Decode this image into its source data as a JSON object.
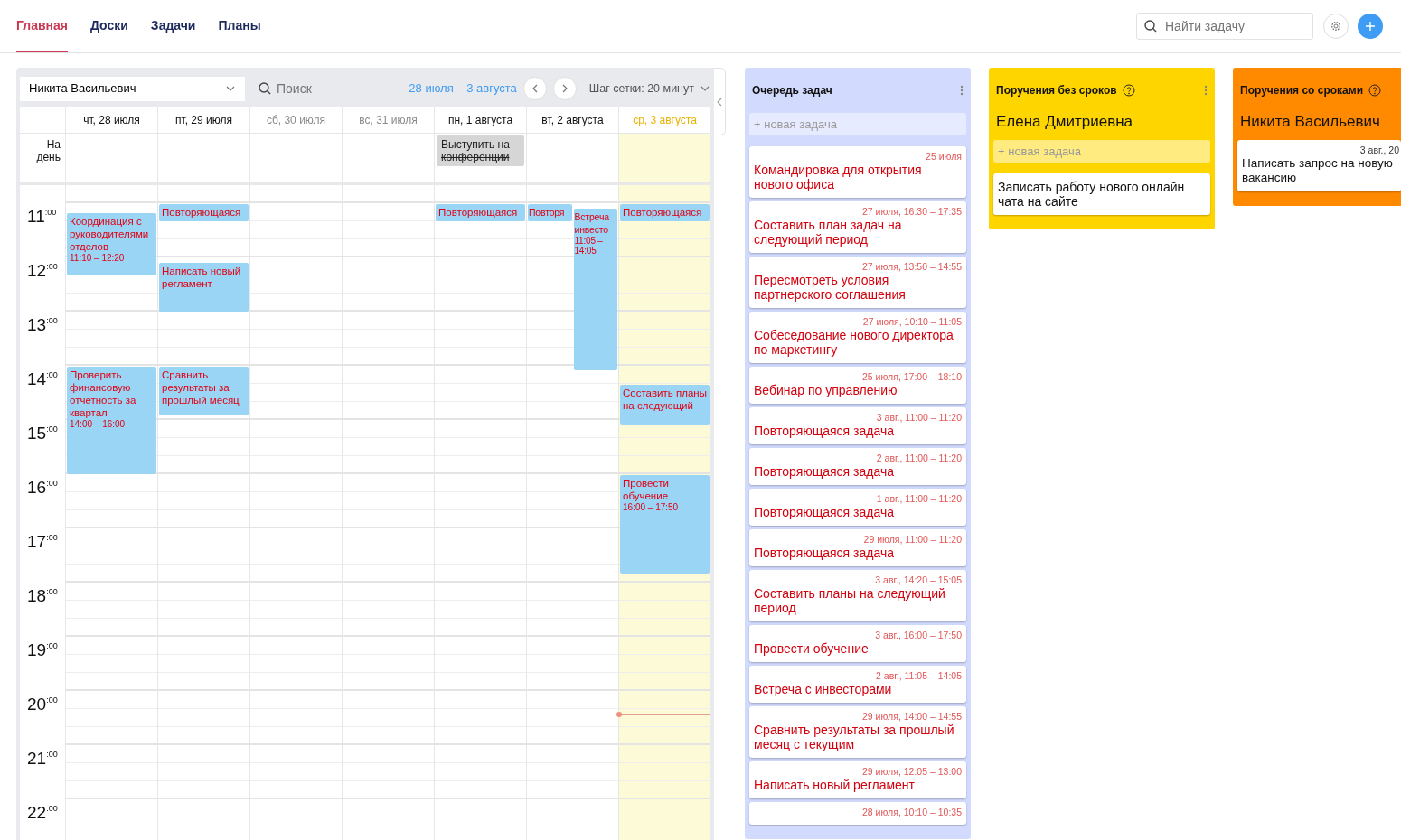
{
  "nav": {
    "tabs": [
      {
        "label": "Главная",
        "selected": true
      },
      {
        "label": "Доски",
        "selected": false
      },
      {
        "label": "Задачи",
        "selected": false
      },
      {
        "label": "Планы",
        "selected": false
      }
    ],
    "search": {
      "placeholder": "Найти задачу"
    }
  },
  "calendar": {
    "user": "Никита Васильевич",
    "search": {
      "placeholder": "Поиск"
    },
    "range": "28 июля – 3 августа",
    "grid_step": "Шаг сетки: 20 минут",
    "all_day_label": "На день",
    "hours": [
      "11$^{:00}$",
      "12$^{:00}$",
      "13$^{:00}$",
      "14$^{:00}$",
      "15$^{:00}$",
      "16$^{:00}$",
      "17$^{:00}$",
      "18$^{:00}$",
      "19$^{:00}$",
      "20$^{:00}$",
      "21$^{:00}$",
      "22$^{:00}$"
    ],
    "days": [
      {
        "label": "чт, 28 июля",
        "weekend": false,
        "today": false,
        "events": [
          {
            "title": "Координация с руководителями отделов",
            "time": "11:10 – 12:20"
          },
          {
            "title": "Проверить финансовую отчетность за квартал",
            "time": "14:00 – 16:00"
          }
        ]
      },
      {
        "label": "пт, 29 июля",
        "weekend": false,
        "today": false,
        "events": [
          {
            "title": "Повторяющаяся"
          },
          {
            "title": "Написать новый регламент"
          },
          {
            "title": "Сравнить результаты за прошлый месяц"
          }
        ]
      },
      {
        "label": "сб, 30 июля",
        "weekend": true,
        "today": false
      },
      {
        "label": "вс, 31 июля",
        "weekend": true,
        "today": false
      },
      {
        "label": "пн, 1 августа",
        "weekend": false,
        "today": false,
        "all_day": [
          {
            "title": "Выступить на конференции",
            "done": true
          }
        ],
        "events": [
          {
            "title": "Повторяющаяся"
          }
        ]
      },
      {
        "label": "вт, 2 августа",
        "weekend": false,
        "today": false,
        "events": [
          {
            "title": "Повторя"
          },
          {
            "title": "Встреча инвесто",
            "time": "11:05 – 14:05"
          }
        ]
      },
      {
        "label": "ср, 3 августа",
        "weekend": false,
        "today": true,
        "events": [
          {
            "title": "Повторяющаяся"
          },
          {
            "title": "Составить планы на следующий"
          },
          {
            "title": "Провести обучение",
            "time": "16:00 – 17:50"
          }
        ]
      }
    ]
  },
  "columns": [
    {
      "kind": "queue",
      "title": "Очередь задач",
      "color": "#d2dafd",
      "help": false,
      "menu": true,
      "new_task": {
        "placeholder": "+ новая задача"
      },
      "cards": [
        {
          "date": "25 июля",
          "title": "Командировка для открытия нового офиса",
          "overdue": true
        },
        {
          "date": "27 июля, 16:30 – 17:35",
          "title": "Составить план задач на следующий период",
          "overdue": true
        },
        {
          "date": "27 июля, 13:50 – 14:55",
          "title": "Пересмотреть условия партнерского соглашения",
          "overdue": true
        },
        {
          "date": "27 июля, 10:10 – 11:05",
          "title": "Собеседование нового директора по маркетингу",
          "overdue": true
        },
        {
          "date": "25 июля, 17:00 – 18:10",
          "title": "Вебинар по управлению",
          "overdue": true
        },
        {
          "date": "3 авг., 11:00 – 11:20",
          "title": "Повторяющаяся задача",
          "overdue": true
        },
        {
          "date": "2 авг., 11:00 – 11:20",
          "title": "Повторяющаяся задача",
          "overdue": true
        },
        {
          "date": "1 авг., 11:00 – 11:20",
          "title": "Повторяющаяся задача",
          "overdue": true
        },
        {
          "date": "29 июля, 11:00 – 11:20",
          "title": "Повторяющаяся задача",
          "overdue": true
        },
        {
          "date": "3 авг., 14:20 – 15:05",
          "title": "Составить планы на следующий период",
          "overdue": true
        },
        {
          "date": "3 авг., 16:00 – 17:50",
          "title": "Провести обучение",
          "overdue": true
        },
        {
          "date": "2 авг., 11:05 – 14:05",
          "title": "Встреча с инвесторами",
          "overdue": true
        },
        {
          "date": "29 июля, 14:00 – 14:55",
          "title": "Сравнить результаты за прошлый месяц с текущим",
          "overdue": true
        },
        {
          "date": "29 июля, 12:05 – 13:00",
          "title": "Написать новый регламент",
          "overdue": true
        },
        {
          "date": "28 июля, 10:10 – 10:35",
          "overdue": true
        }
      ]
    },
    {
      "kind": "person",
      "title": "Поручения без сроков",
      "color": "#ffd500",
      "help": true,
      "menu": true,
      "person": "Елена Дмитриевна",
      "new_task": {
        "placeholder": "+ новая задача"
      },
      "cards": [
        {
          "title": "Записать работу нового онлайн чата на сайте",
          "overdue": false
        }
      ]
    },
    {
      "kind": "person",
      "title": "Поручения со сроками",
      "color": "#ff8a00",
      "help": true,
      "menu": false,
      "person": "Никита Васильевич",
      "cards": [
        {
          "date": "3 авг., 20",
          "title": "Написать запрос на новую вакансию",
          "overdue": false
        }
      ]
    }
  ]
}
